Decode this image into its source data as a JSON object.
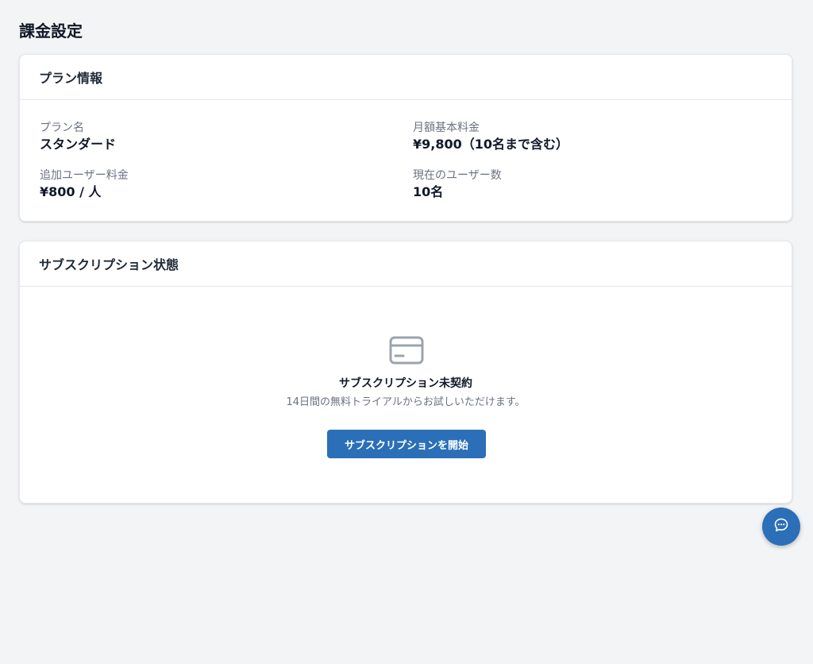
{
  "page": {
    "title": "課金設定"
  },
  "plan_card": {
    "header": "プラン情報",
    "fields": [
      {
        "label": "プラン名",
        "value": "スタンダード"
      },
      {
        "label": "月額基本料金",
        "value": "¥9,800（10名まで含む）"
      },
      {
        "label": "追加ユーザー料金",
        "value": "¥800 / 人"
      },
      {
        "label": "現在のユーザー数",
        "value": "10名"
      }
    ]
  },
  "subscription_card": {
    "header": "サブスクリプション状態",
    "icon": "credit-card-icon",
    "empty_title": "サブスクリプション未契約",
    "empty_description": "14日間の無料トライアルからお試しいただけます。",
    "start_button_label": "サブスクリプションを開始"
  },
  "chat_button": {
    "icon": "chat-bubble-icon"
  },
  "colors": {
    "accent": "#2a6fb7",
    "background": "#f3f4f6",
    "muted_text": "#6b7280",
    "icon_gray": "#9ca3af"
  }
}
